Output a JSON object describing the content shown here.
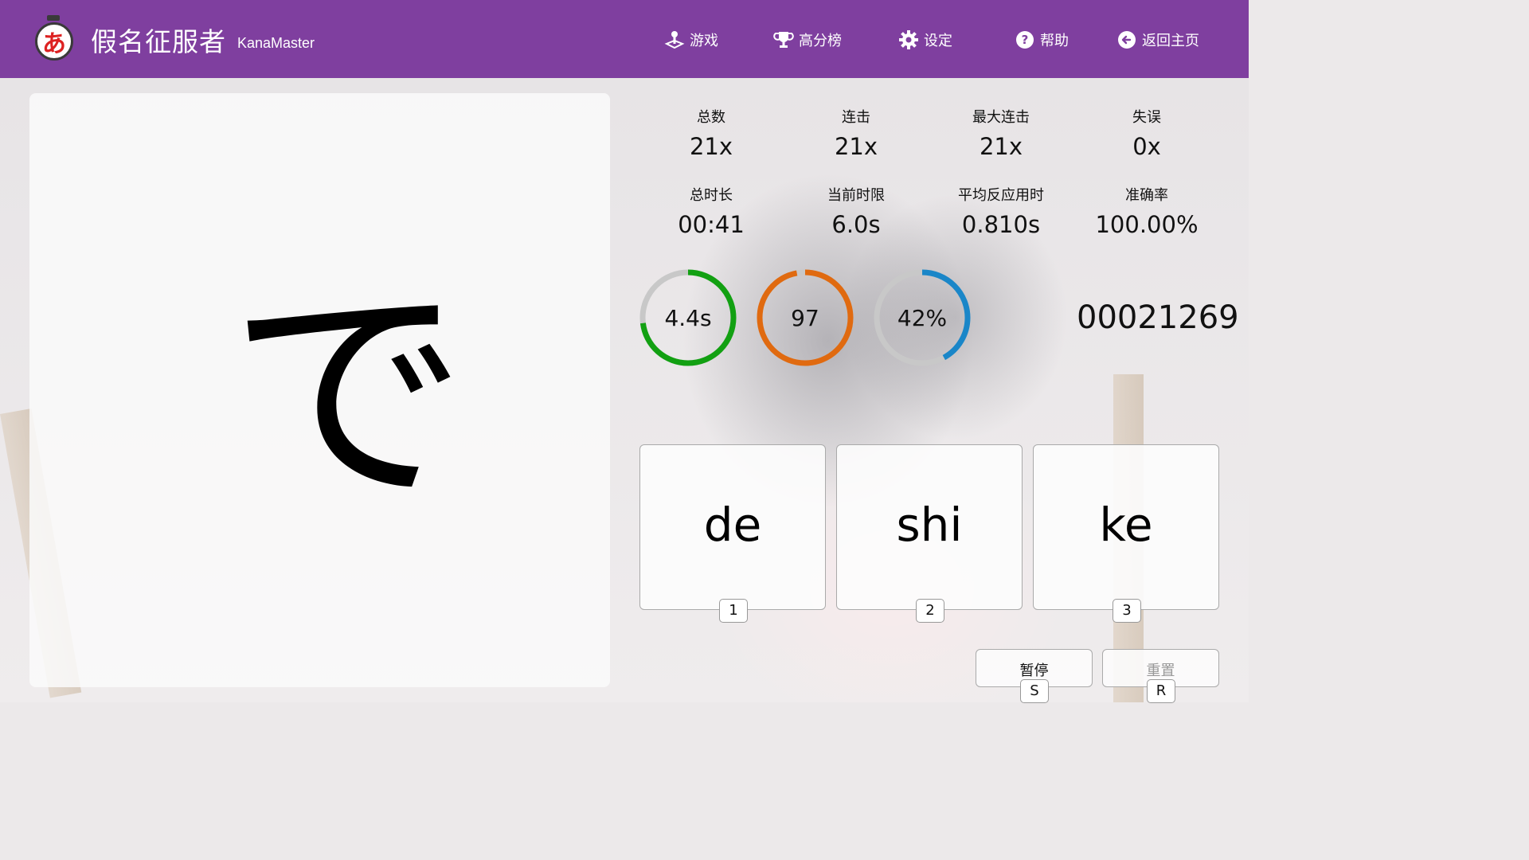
{
  "header": {
    "logo_char": "あ",
    "title": "假名征服者",
    "subtitle": "KanaMaster",
    "nav": [
      {
        "label": "游戏",
        "icon": "joystick-icon"
      },
      {
        "label": "高分榜",
        "icon": "trophy-icon"
      },
      {
        "label": "设定",
        "icon": "gear-icon"
      },
      {
        "label": "帮助",
        "icon": "help-circle-icon"
      },
      {
        "label": "返回主页",
        "icon": "back-arrow-icon"
      }
    ],
    "bg_color": "#7f3f9f"
  },
  "question": {
    "kana": "で"
  },
  "stats": [
    {
      "label": "总数",
      "value": "21x"
    },
    {
      "label": "连击",
      "value": "21x"
    },
    {
      "label": "最大连击",
      "value": "21x"
    },
    {
      "label": "失误",
      "value": "0x"
    },
    {
      "label": "总时长",
      "value": "00:41"
    },
    {
      "label": "当前时限",
      "value": "6.0s"
    },
    {
      "label": "平均反应用时",
      "value": "0.810s"
    },
    {
      "label": "准确率",
      "value": "100.00%"
    }
  ],
  "rings": [
    {
      "text": "4.4s",
      "fraction": 0.73,
      "color": "#12a012"
    },
    {
      "text": "97",
      "fraction": 0.97,
      "color": "#e06a10"
    },
    {
      "text": "42%",
      "fraction": 0.42,
      "color": "#1a86c8"
    }
  ],
  "score": "00021269",
  "answers": [
    {
      "text": "de",
      "key": "1"
    },
    {
      "text": "shi",
      "key": "2"
    },
    {
      "text": "ke",
      "key": "3"
    }
  ],
  "controls": {
    "pause": {
      "label": "暂停",
      "key": "S"
    },
    "reset": {
      "label": "重置",
      "key": "R"
    }
  }
}
